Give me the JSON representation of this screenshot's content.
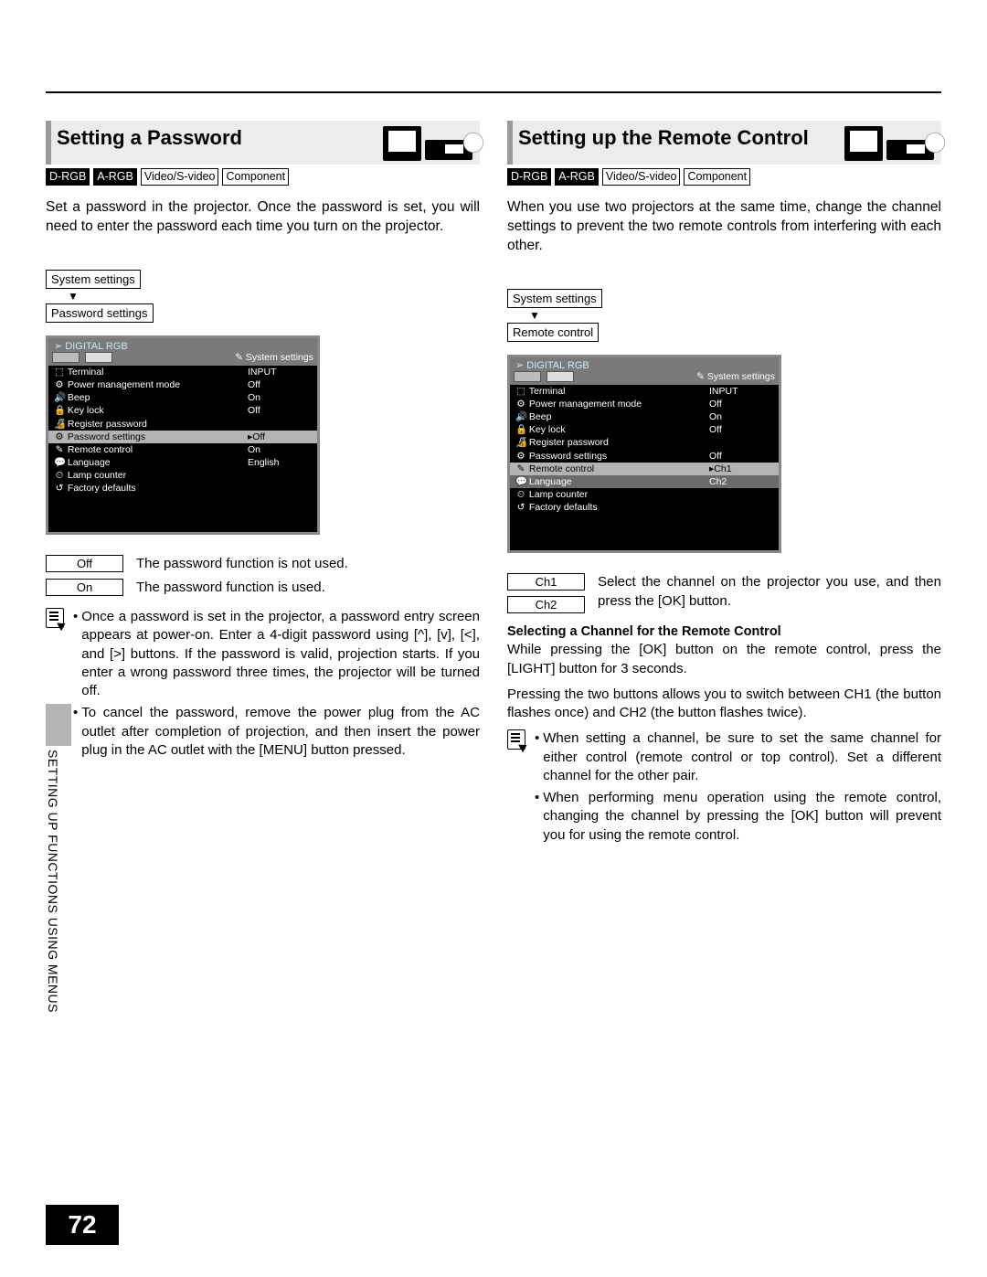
{
  "pageNumber": "72",
  "sideLabel": "SETTING UP FUNCTIONS USING MENUS",
  "input_tags": [
    "D-RGB",
    "A-RGB",
    "Video/S-video",
    "Component"
  ],
  "left": {
    "title": "Setting a Password",
    "intro": "Set a password in the projector. Once the password is set, you will need to enter the password each time you turn on the projector.",
    "menu_path": [
      "System settings",
      "Password settings"
    ],
    "osd": {
      "title": "DIGITAL RGB",
      "tab_label": "System settings",
      "rows": [
        {
          "icon": "⬚",
          "k": "Terminal",
          "v": "INPUT"
        },
        {
          "icon": "⚙",
          "k": "Power management mode",
          "v": "Off"
        },
        {
          "icon": "🔊",
          "k": "Beep",
          "v": "On"
        },
        {
          "icon": "🔒",
          "k": "Key lock",
          "v": "Off"
        },
        {
          "icon": "🔏",
          "k": "Register password",
          "v": ""
        },
        {
          "icon": "⚙",
          "k": "Password settings",
          "v": "▸Off",
          "sel": true
        },
        {
          "icon": "✎",
          "k": "Remote control",
          "v": "On"
        },
        {
          "icon": "💬",
          "k": "Language",
          "v": "English"
        },
        {
          "icon": "⏲",
          "k": "Lamp counter",
          "v": ""
        },
        {
          "icon": "↺",
          "k": "Factory defaults",
          "v": ""
        }
      ]
    },
    "options": [
      {
        "label": "Off",
        "desc": "The password function is not used."
      },
      {
        "label": "On",
        "desc": "The password function is used."
      }
    ],
    "notes": [
      "Once a password is set in the projector, a password entry screen appears at power-on.  Enter a 4-digit password using [^], [v], [<], and [>] buttons. If the password is valid, projection starts. If you enter a wrong password three times, the projector will be turned off.",
      "To cancel the password, remove the power plug from the AC outlet after completion of projection, and then insert the power plug in the AC outlet with the [MENU] button pressed."
    ]
  },
  "right": {
    "title": "Setting up the Remote Control",
    "intro": "When you use two projectors at the same time, change the channel settings to prevent the two remote controls from interfering with each other.",
    "menu_path": [
      "System settings",
      "Remote control"
    ],
    "osd": {
      "title": "DIGITAL RGB",
      "tab_label": "System settings",
      "rows": [
        {
          "icon": "⬚",
          "k": "Terminal",
          "v": "INPUT"
        },
        {
          "icon": "⚙",
          "k": "Power management mode",
          "v": "Off"
        },
        {
          "icon": "🔊",
          "k": "Beep",
          "v": "On"
        },
        {
          "icon": "🔒",
          "k": "Key lock",
          "v": "Off"
        },
        {
          "icon": "🔏",
          "k": "Register password",
          "v": ""
        },
        {
          "icon": "⚙",
          "k": "Password settings",
          "v": "Off"
        },
        {
          "icon": "✎",
          "k": "Remote control",
          "v": "▸Ch1",
          "sel": true
        },
        {
          "icon": "💬",
          "k": "Language",
          "v": "Ch2",
          "dim": true
        },
        {
          "icon": "⏲",
          "k": "Lamp counter",
          "v": ""
        },
        {
          "icon": "↺",
          "k": "Factory defaults",
          "v": ""
        }
      ]
    },
    "options": [
      {
        "label": "Ch1",
        "desc_combined": "Select the channel on the projector you use, and then press the [OK] button."
      },
      {
        "label": "Ch2"
      }
    ],
    "subhead": "Selecting a Channel for the Remote Control",
    "para1": "While pressing the [OK] button on the remote control, press the [LIGHT] button for 3 seconds.",
    "para2": "Pressing the two buttons allows you to switch between CH1 (the button flashes once) and CH2 (the button flashes twice).",
    "notes": [
      "When setting a channel, be sure to set the same channel for either control (remote control or top control). Set a different channel for the other pair.",
      "When performing menu operation using the remote control, changing the channel by pressing the [OK] button will prevent you for using the remote control."
    ]
  }
}
